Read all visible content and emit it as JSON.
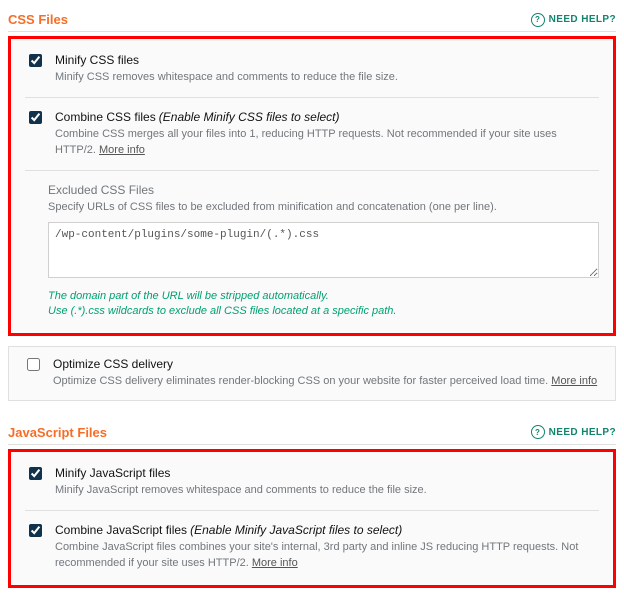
{
  "css": {
    "title": "CSS Files",
    "help": "NEED HELP?",
    "minify": {
      "label": "Minify CSS files",
      "desc": "Minify CSS removes whitespace and comments to reduce the file size."
    },
    "combine": {
      "label": "Combine CSS files",
      "hint": "(Enable Minify CSS files to select)",
      "desc": "Combine CSS merges all your files into 1, reducing HTTP requests. Not recommended if your site uses HTTP/2.",
      "more": "More info"
    },
    "exclude": {
      "title": "Excluded CSS Files",
      "desc": "Specify URLs of CSS files to be excluded from minification and concatenation (one per line).",
      "value": "/wp-content/plugins/some-plugin/(.*).css",
      "note1": "The domain part of the URL will be stripped automatically.",
      "note2": "Use (.*).css wildcards to exclude all CSS files located at a specific path."
    },
    "optimize": {
      "label": "Optimize CSS delivery",
      "desc": "Optimize CSS delivery eliminates render-blocking CSS on your website for faster perceived load time.",
      "more": "More info"
    }
  },
  "js": {
    "title": "JavaScript Files",
    "help": "NEED HELP?",
    "minify": {
      "label": "Minify JavaScript files",
      "desc": "Minify JavaScript removes whitespace and comments to reduce the file size."
    },
    "combine": {
      "label": "Combine JavaScript files",
      "hint": "(Enable Minify JavaScript files to select)",
      "desc": "Combine JavaScript files combines your site's internal, 3rd party and inline JS reducing HTTP requests. Not recommended if your site uses HTTP/2.",
      "more": "More info"
    }
  }
}
